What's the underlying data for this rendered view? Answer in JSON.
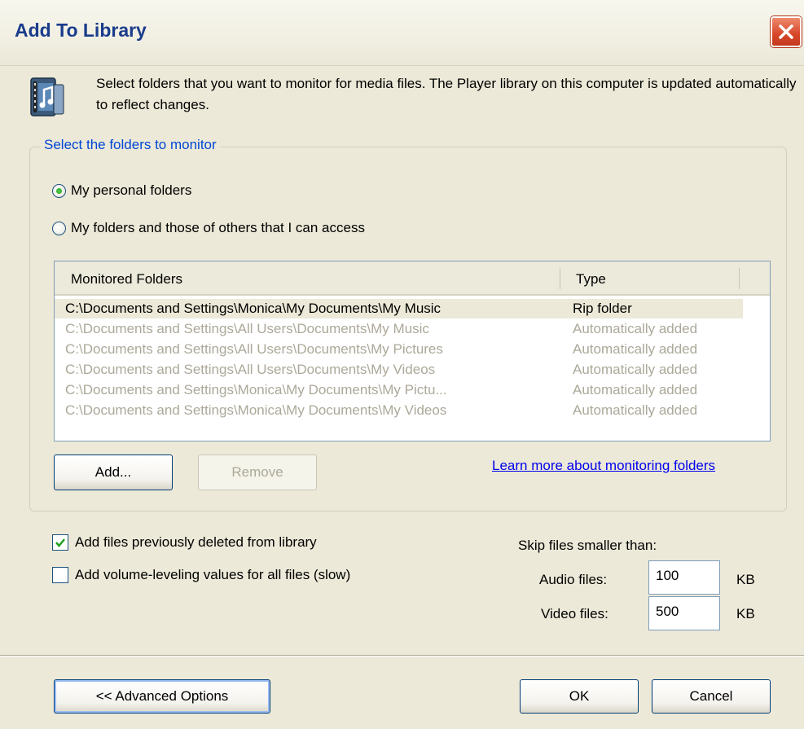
{
  "window": {
    "title": "Add To Library",
    "intro": "Select folders that you want to monitor for media files. The Player library on this computer is updated automatically to reflect changes."
  },
  "monitor_group": {
    "legend": "Select the folders to monitor",
    "radio_options": [
      {
        "label": "My personal folders",
        "checked": true
      },
      {
        "label": "My folders and those of others that I can access",
        "checked": false
      }
    ],
    "columns": [
      "Monitored Folders",
      "Type"
    ],
    "rows": [
      {
        "folder": "C:\\Documents and Settings\\Monica\\My Documents\\My Music",
        "type": "Rip folder"
      },
      {
        "folder": "C:\\Documents and Settings\\All Users\\Documents\\My Music",
        "type": "Automatically added"
      },
      {
        "folder": "C:\\Documents and Settings\\All Users\\Documents\\My Pictures",
        "type": "Automatically added"
      },
      {
        "folder": "C:\\Documents and Settings\\All Users\\Documents\\My Videos",
        "type": "Automatically added"
      },
      {
        "folder": "C:\\Documents and Settings\\Monica\\My Documents\\My Pictu...",
        "type": "Automatically added"
      },
      {
        "folder": "C:\\Documents and Settings\\Monica\\My Documents\\My Videos",
        "type": "Automatically added"
      }
    ],
    "add_label": "Add...",
    "remove_label": "Remove",
    "learn_more": "Learn more about monitoring folders"
  },
  "options": {
    "add_deleted": {
      "label": "Add files previously deleted from library",
      "checked": true
    },
    "volume_leveling": {
      "label": "Add volume-leveling values for all files (slow)",
      "checked": false
    }
  },
  "skip": {
    "heading": "Skip files smaller than:",
    "audio_label": "Audio files:",
    "audio_value": "100",
    "video_label": "Video files:",
    "video_value": "500",
    "unit": "KB"
  },
  "footer": {
    "advanced_label": "<< Advanced Options",
    "ok_label": "OK",
    "cancel_label": "Cancel"
  },
  "colors": {
    "accent": "#0046d5",
    "title_text": "#1a3c8c",
    "dialog_bg": "#ece9d8",
    "muted_text": "#aca899"
  }
}
